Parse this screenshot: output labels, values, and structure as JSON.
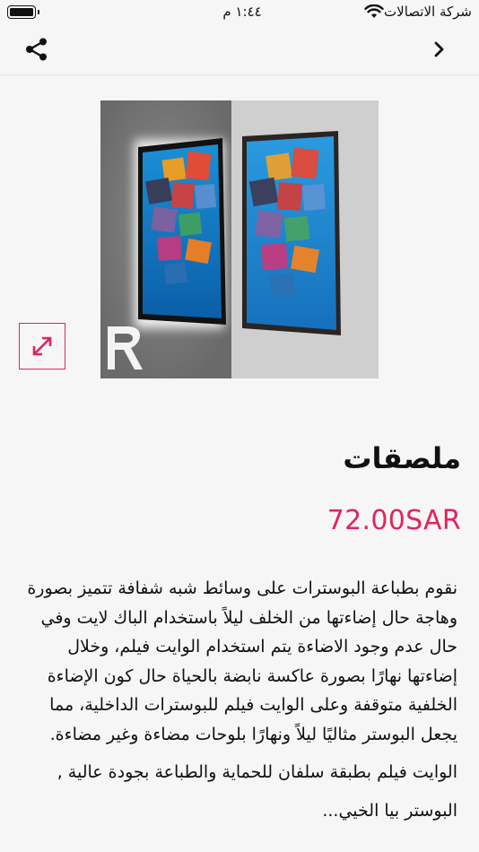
{
  "status_bar": {
    "carrier": "شركة الاتصالات",
    "time": "١:٤٤ م",
    "icons": [
      "wifi-icon",
      "battery-icon"
    ]
  },
  "nav": {
    "icons": [
      "share-icon",
      "chevron-right-icon"
    ]
  },
  "product": {
    "image_icon": "expand-icon",
    "title": "ملصقات",
    "price": "72.00SAR",
    "description_paragraphs": [
      "نقوم بطباعة البوسترات على وسائط شبه شفافة تتميز بصورة وهاجة حال إضاءتها من الخلف ليلاً باستخدام الباك لايت وفي حال عدم وجود الاضاءة يتم استخدام الوايت فيلم، وخلال إضاءتها نهارًا بصورة عاكسة نابضة بالحياة حال كون الإضاءة الخلفية متوقفة وعلى الوايت فيلم للبوسترات الداخلية، مما يجعل البوستر مثاليًا ليلاً ونهارًا بلوحات مضاءة وغير مضاءة.",
      "الوايت فيلم بطبقة سلفان للحماية والطباعة بجودة عالية ,",
      "البوستر بيا الخيي..."
    ]
  },
  "colors": {
    "accent": "#e0245e",
    "background": "#f6f6f6",
    "text": "#111111"
  }
}
